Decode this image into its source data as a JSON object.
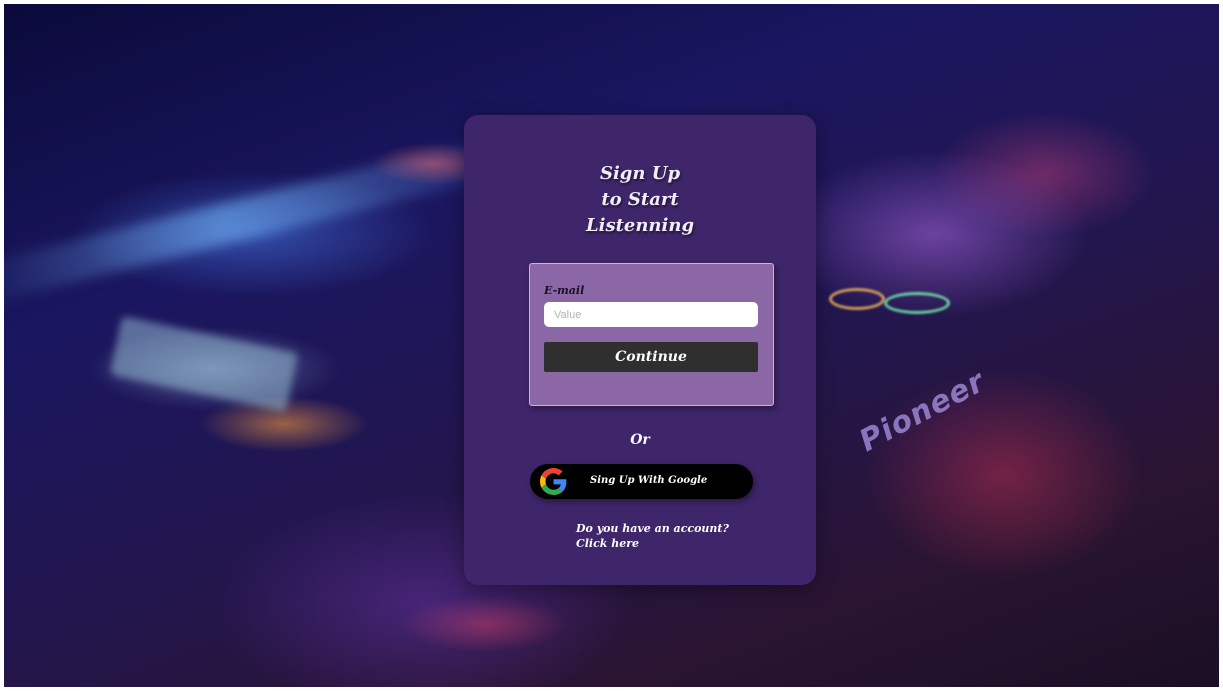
{
  "background": {
    "description_icon": "dj-mixer-background-image",
    "brand_text": "Pioneer"
  },
  "card": {
    "title_lines": [
      "Sign Up",
      "to Start",
      "Listenning"
    ],
    "form": {
      "email_label": "E-mail",
      "email_placeholder": "Value",
      "email_value": "",
      "continue_label": "Continue"
    },
    "or_label": "Or",
    "google_button": {
      "icon": "google-icon",
      "label": "Sing Up With Google"
    },
    "account_prompt": "Do you have an account?",
    "account_link": "Click here"
  },
  "colors": {
    "card_bg": "#3f2569",
    "form_bg": "#8b67a6",
    "continue_bg": "#2f2f2f",
    "google_bg": "#000000"
  }
}
